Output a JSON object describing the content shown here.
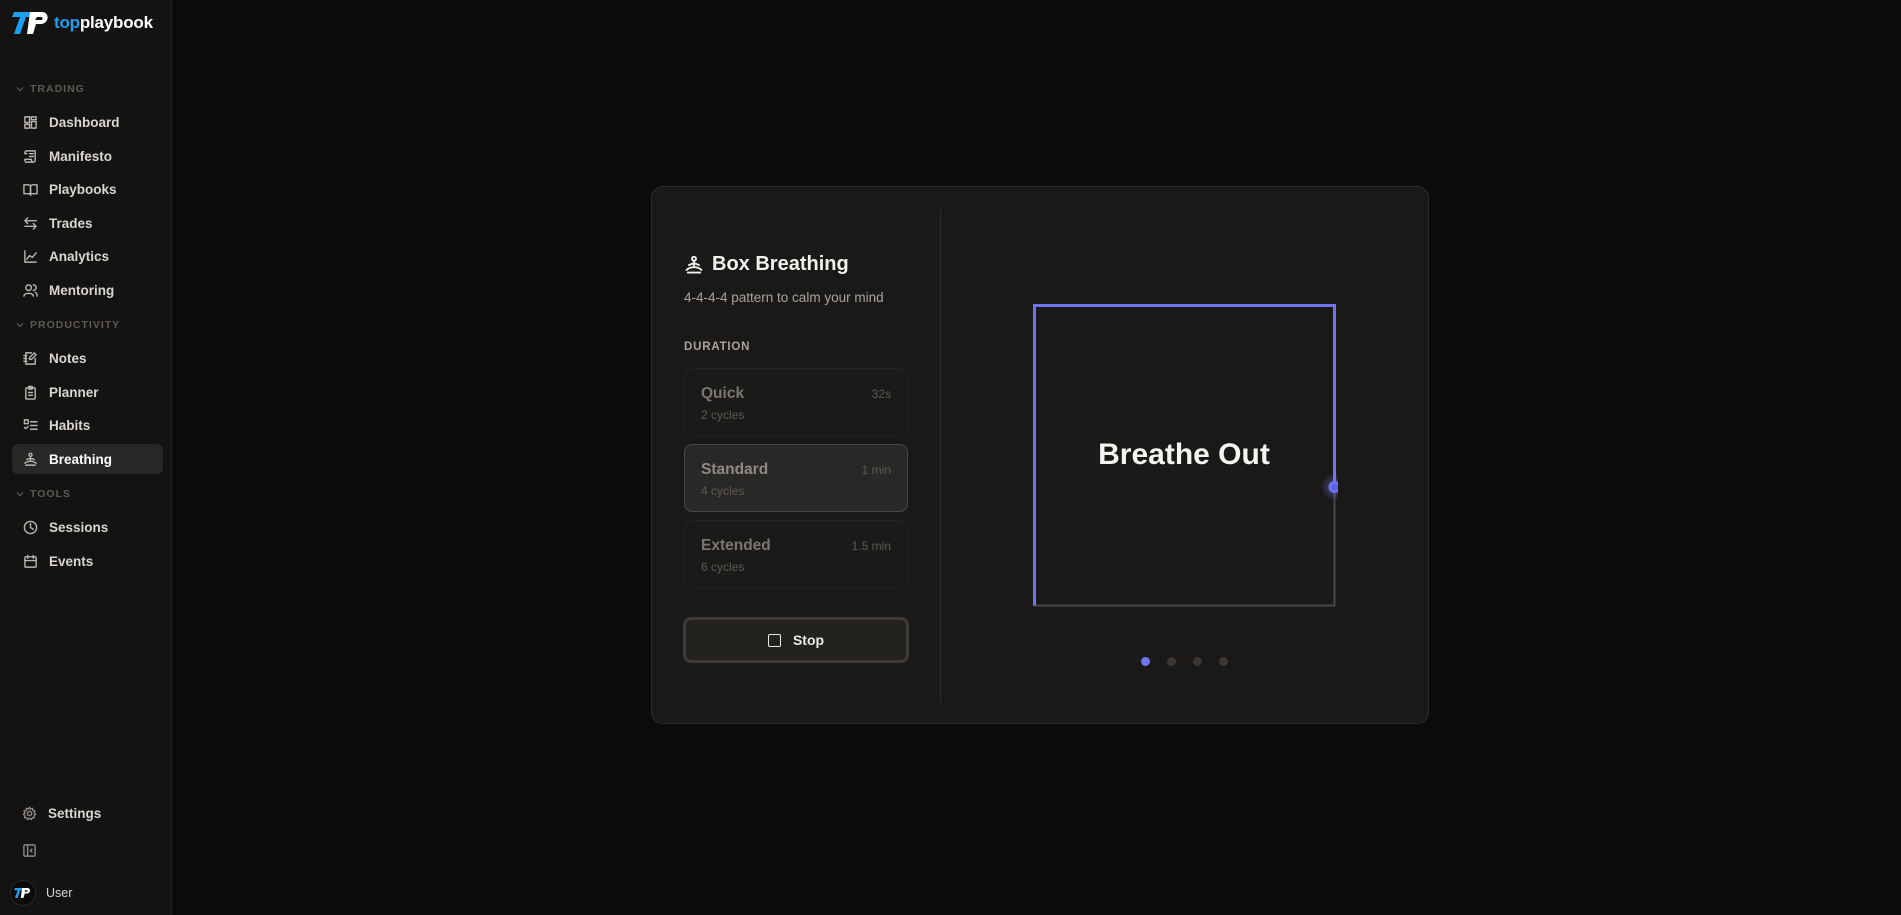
{
  "app": {
    "logo_word_top": "top",
    "logo_word_playbook": "playbook"
  },
  "sidebar": {
    "sections": [
      {
        "label": "TRADING"
      },
      {
        "label": "PRODUCTIVITY"
      },
      {
        "label": "TOOLS"
      }
    ],
    "items": [
      {
        "label": "Dashboard",
        "icon": "dashboard-icon"
      },
      {
        "label": "Manifesto",
        "icon": "scroll-icon"
      },
      {
        "label": "Playbooks",
        "icon": "book-open-icon"
      },
      {
        "label": "Trades",
        "icon": "arrows-left-right-icon"
      },
      {
        "label": "Analytics",
        "icon": "chart-line-icon"
      },
      {
        "label": "Mentoring",
        "icon": "users-icon"
      },
      {
        "label": "Notes",
        "icon": "notebook-pen-icon"
      },
      {
        "label": "Planner",
        "icon": "clipboard-icon"
      },
      {
        "label": "Habits",
        "icon": "list-checks-icon"
      },
      {
        "label": "Breathing",
        "icon": "meditation-icon",
        "active": true
      },
      {
        "label": "Sessions",
        "icon": "clock-icon"
      },
      {
        "label": "Events",
        "icon": "calendar-icon"
      }
    ],
    "settings_label": "Settings",
    "collapse_icon": "sidebar-collapse-icon",
    "user_label": "User"
  },
  "breathing": {
    "title": "Box Breathing",
    "subtitle": "4-4-4-4 pattern to calm your mind",
    "duration_label": "DURATION",
    "options": [
      {
        "name": "Quick",
        "time": "32s",
        "cycles": "2 cycles"
      },
      {
        "name": "Standard",
        "time": "1 min",
        "cycles": "4 cycles",
        "selected": true
      },
      {
        "name": "Extended",
        "time": "1.5 min",
        "cycles": "6 cycles"
      }
    ],
    "stop_label": "Stop",
    "phase_text": "Breathe Out",
    "current_phase_index": 0,
    "phase_count": 4,
    "colors": {
      "accent": "#6d76f0",
      "track": "#4a4744"
    }
  }
}
